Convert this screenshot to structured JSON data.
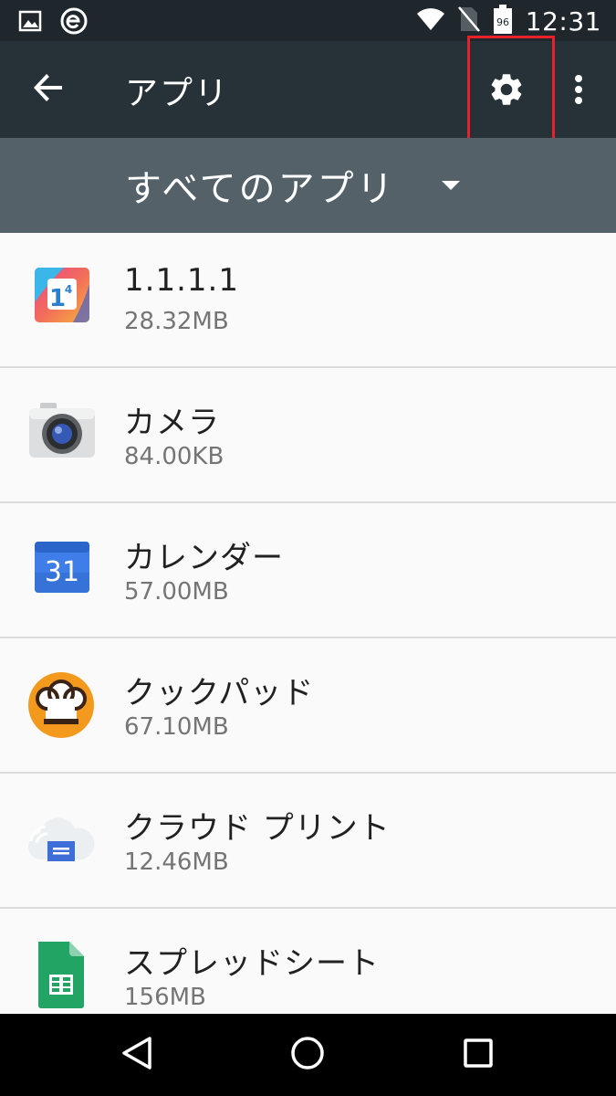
{
  "status_bar": {
    "time": "12:31",
    "battery_level": "96",
    "icons": [
      "image-notification-icon",
      "e-notification-icon",
      "wifi-icon",
      "no-sim-icon",
      "battery-icon"
    ]
  },
  "app_bar": {
    "title": "アプリ",
    "back_icon": "arrow-back-icon",
    "settings_icon": "gear-icon",
    "more_icon": "more-vert-icon"
  },
  "filter": {
    "selected": "すべてのアプリ"
  },
  "apps": [
    {
      "name": "1.1.1.1",
      "size": "28.32MB",
      "icon": "1111-app-icon"
    },
    {
      "name": "カメラ",
      "size": "84.00KB",
      "icon": "camera-app-icon"
    },
    {
      "name": "カレンダー",
      "size": "57.00MB",
      "icon": "calendar-app-icon",
      "icon_text": "31"
    },
    {
      "name": "クックパッド",
      "size": "67.10MB",
      "icon": "cookpad-app-icon"
    },
    {
      "name": "クラウド プリント",
      "size": "12.46MB",
      "icon": "cloud-print-app-icon"
    },
    {
      "name": "スプレッドシート",
      "size": "156MB",
      "icon": "sheets-app-icon"
    }
  ],
  "app_1111_icon_text": "1",
  "app_1111_icon_sup": "4",
  "nav_bar": {
    "icons": [
      "back-triangle-icon",
      "home-circle-icon",
      "recents-square-icon"
    ]
  },
  "colors": {
    "status_bar": "#1f272c",
    "app_bar": "#263238",
    "filter_bar": "#546168",
    "highlight": "#e8202a",
    "list_bg": "#fafafa"
  }
}
